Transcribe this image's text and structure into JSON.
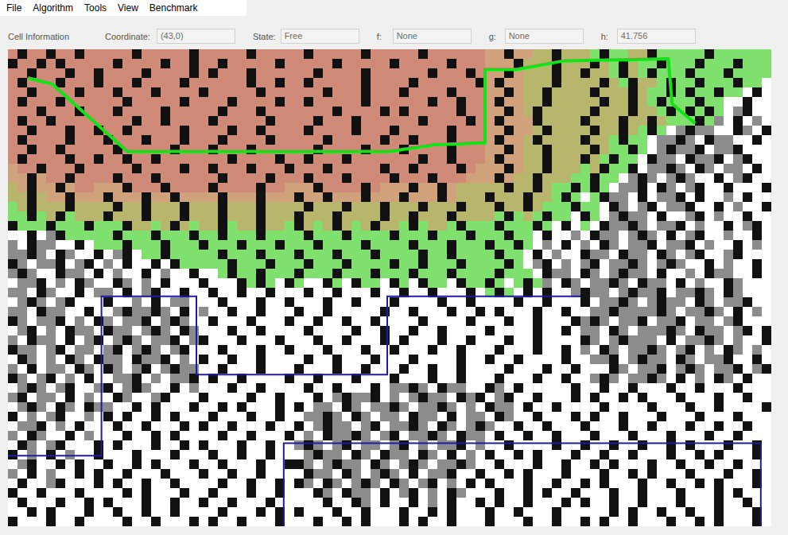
{
  "menu": [
    "File",
    "Algorithm",
    "Tools",
    "View",
    "Benchmark"
  ],
  "info": {
    "title": "Cell Information",
    "fields": [
      {
        "label": "Coordinate:",
        "value": "(43,0)"
      },
      {
        "label": "State:",
        "value": "Free"
      },
      {
        "label": "f:",
        "value": "None"
      },
      {
        "label": "g:",
        "value": "None"
      },
      {
        "label": "h:",
        "value": "41.756"
      }
    ]
  },
  "grid": {
    "rows": [
      "r#rr#rr#rrrrr#rrrrr#rrrrr#rrrrr#rrrrr#rrrrr#rrrrrroo#ooyy#yyyl#llyy#lllll#llllll",
      "#rr#r#rrrrr#rrrr#rr#rr#rrrrr#rrrrr#rrrrr#rrrrr#rrrooo#yyy#yyy#yl#yll#lll#lll#lll",
      "rr#rrr#rr#rrrr#rrrr#r#rrr#rrrrrr#rrrr#rrrrrr#rrr#roo#oyyy#yy#yyl#yl#lll#lll#llll",
      "r#rrr#rrr#rrr#rrrr#rrrrrr#rr#rr#rrrrr#rrrr#rrrrrr#o#ooyyy#yyyy#yl#yyl#ll#lll#ll.",
      "rr#rrrr#rrr#rrr#rrrr#rrrrr#rrrrrr#rrr#rrr#rrrr#rrroo#oyy#yyyy#yyy#yll#l#ll#ll.#.",
      "r#rrr#rrrrrr#rrrrr#rrrr#rrrr#rr#rrrrr#rrrrrr#rr#rro#ooyy#yyyyy#yy#yl#lll#ll..#..",
      "rrr#rrr#rrr#rrrr#rrrrr#rrr#rrrrrrr#rrrr#r#rrrrr#rroo#oy#yyyyy#yyy#yyl#l#l#l.g#..",
      "r#rr#rrrrrrrr#rr#rrrr#rrrrr#rrrr#rrr#rrrrrr#rrrr#ro#ooo#yyyy#yyy#yy#ylll#lg.#.g.",
      "rr#rrr#rr#rr#rrrrr#rrrr#rr#rrrr#rrrr#rrr#rrrrr#rrroo#ooy#yyyy#yy#yl#l.g#gg..#g.#",
      "r#rrrr#rrr#rrr#rrr#rrr#rrrr#rrrrr#rrrrr#rr#rrr#rrro#ooy#yyyy#yyl#ll.gg#g.#gg..#.",
      "rr#rr#rrrrr#rrrrr#rrr#rrr#rrrrrr#rrrr#rrr#rrrr#rrroo#oyy#yyyy#yll#l.g#gg#.gg#...",
      "r#rrrr#rr#rr#rr#rrrrrrr#rrrr#rr#rrr#rrrrrrr#rr#rrro#ooyy#yyy#yl#ll.#gg.#gg#.g#..",
      "orr#rrr#rrrrr#rrrr#rr#rrr#rrr#rrr#rrrrr#rr#rrrr#rooo#oyy#yyyly#ll#.gg#g.#g.gg.#.",
      "oo#orr#rrrr#rrr#rrrrrr#rrrr#rrr#rrr#rrrr#rrr#rrrooo#oyy#yyyll#ll.g#g.g#g..#.g#..",
      "yo#oo#orrooo#rrr#rrrr#rrrr#rrooo#rrrr#rooo#oo#oyyyyy#yy#yll#l#l.gg#.#g.g#..#...#",
      "yy#yoo#ooo#ooo#oo#oooo#ooo#ooo#oo#ooo#ooo#ooo#oyyy#yyy#yyl#l.l#gg.#.gg#.#..g.#..",
      "ly#yyy#yyyy#yy#yyy#yyy#yyy#yyyy#yyy#yyy#yyy#yyy#yyy#yy#ylll#ll.#g.g#.gg#..#.g..#",
      "ll#ly#lyyy#yyy#yyy#yyy#yyy#yyy#yyy#yyyy#yy#yyy#yyyyl#lyl#ll.#l.g#gg.#..g#.g..#..",
      "#lll#lll#lll#yyly#ylyy#lyy#yyl#yly#yly#yyl#lyyl#lll#lll#l.#.l.#gg#g.gg#.g..#.g#.",
      "..#.g#lllll#lll#lll#ll#lll#llll#lll#llll#lll#lll#lll#ll.#..g.#gg.g#g.#.g#..g..#.",
      "g.#gg..#.lll#lll#lll#lll#lll#lll#llll#llll#lll#lll#ll#l.g.#.g.#g.gg#.gg#.g..#.g.",
      "gg#g.#g..#.g#.ll#lllll#lll#lll#lll#lll#llll#ll#llll#ll.#.g..#gg.#gg.#g.g#..g#...",
      "#g.gg#.g#.g.#..#.#lllll#lll#lll#lll#llll#ll#lll#llll#l.g#.g.g#.gg#g.g#g..#.g..#.",
      "g#g..#gg.#.g..#.g..#..l#ll#lll#lll#lll#lll#lll#llll#lll.#gg.#g.g#gg.#..g.#gg..#.",
      ".gg#.g.#g..#g.g.#...#...#l#l.#l..#l.#ll.#l.#ll.#ll#l.l#lg.#g.gg#g.#gg.#.g..#g...",
      "gg.#g..#.gg.#.g#..#..#..#..#...#..#...#..#..#...#.l#l.#.#..g#gg.g#gg#.gg#g.#g..",
      ".g#g.g#...#..g.#.gg...#...#..#...#..#...#....#..#....#..#...#.gg#g.g#gg.#g.gg#..",
      "gg.#gg..#..g#gg#g.#.g..#..#...#..#.....#..#...#..#.#...#..#..gg#gggg#g.gg#g.#.g.",
      "#g.gg#.g.#g.gg#.g#g..#...#...#..#..#..#....#....#...#..#...#g#g.gg#.gg#.gg.g#...",
      ".g#.g.#gg.#gg.g#g.#g...#..#....#....#..#..#..#....#....#..#.gg.#g.ggg#g.#gg.g#.#",
      "g.#gg.#.g#.g#g.gg#.g#...#...#...#..#...#.#...#..#...#..#....#g.g#ggg.#.gg#g.g..#",
      "#gg.g#.gg.g#.g#g.g#...#...#..#...#...#..#...#..#...#...#..#.g.#g.gg#g.g#.g.#g.g.",
      ".#g.g.#g.#gg.#gg#.g.#..#..#....#..#...#...#....#..#..#....#..gg#.g#gg.#g.gg#..#.",
      "g.#.gg.#g.#g.g#.g#gg..#...#...#...#..#...#..#..#....#...#..#...#g.gg#.g#g.gg#.g#g..",
      "#g.g#.g.#..gg#.g.gg#.#..#....#..#...#...#...#..#...#...#..#..g#g.gg#g.#.g.#g.#..",
      ".g#g.g#..g#.g#g..#.g...#..#....#..#...#.gg#g.#gg..#g.#.....#..#..#...#..#...#...",
      "g#.gg.#.g..#g..g#...#....#..#...#.g#gg#.g.g#gg.#g#.g#..#...#.#..#.#...#...#..#..",
      ".g#g.#g.#gg..#.#...#..#.#...#.#.gg.#g.gg#g.gg#g.g.#gg.#..#....#....#...#..#....#",
      "#.g.g#..g.#.#..#.#...#...#..#..gg#g.#g.gg.#gg.#.gg.#g..#...#.#..#...#...#...#...",
      ".gg#.g.#...#..#...#.#..#...#..#.g#gg.g#.gg#g.#g.g#g..#..#...#...#..#...#..#..#..",
      "g.#g..#.g...#..#.#....#..#...#.g.#gg#g.g#.gg#g.#gg.#..#..#...#...#...#...#..#...",
      ".#g.g#...#.#...#..#.#...#..#..g#g.g#.gg.g#.g.gg#.g..#....#..#..#..#..#.#...#..#.",
      "#.g.#.g..#...#...#...#..#..#...g#gg.#g.#gg.#g.#.g.#..#.#...#..#..#...#..#.#...#.",
      ".g#..#.#..#..#.#...#..#...#..##g.g#gg.#g.g#g.gg#g..#...#..#..#.#...#..#..#..#...",
      "g.#.g..#.#..#...#...#..#..#....#gg.#g.g#g.#.gg#..#..#.#...#...#..#.#...#...#..#.",
      ".#..g#...#.#..#..#....#..#..#.#g.#g.g#g.#g.g#.g.#.#...#..#..#.#...#..#..#.#...#.",
      "#..#...#....#.#...#..#...#..#...#g.#gg.#.g#.g.#g...#..#.#..#...#..#...#...#.#...",
      ".#...#..#.#...#..#..#..#...#.....#..#g.#..#.g.#..#.#..#...#.#..#..#...#...#..#..#.",
      "..#.#...#..#..#..#....#...#.#.#...#..#...#..#.#...#..#...#.....#.#..#..#..#...#..",
      "#...#..#....#..#...#.#..#...#...#..#.#...#.#..#...#...#..#..#.#..#...#..#.#...#..#."
    ]
  },
  "path": [
    [
      2.1,
      3
    ],
    [
      4.6,
      3.6
    ],
    [
      12.5,
      10.7
    ],
    [
      40,
      10.7
    ],
    [
      44.6,
      10
    ],
    [
      50,
      9.8
    ],
    [
      50,
      2.1
    ],
    [
      53.3,
      2.1
    ],
    [
      58.3,
      1.2
    ],
    [
      69.2,
      1
    ],
    [
      69.6,
      5.7
    ],
    [
      72,
      7.75
    ]
  ],
  "regions": [
    [
      [
        0,
        42.6
      ],
      [
        9.8,
        42.6
      ],
      [
        9.8,
        25.9
      ],
      [
        19.75,
        25.9
      ],
      [
        19.75,
        34.1
      ],
      [
        39.75,
        34.1
      ],
      [
        39.75,
        25.9
      ],
      [
        60,
        25.9
      ]
    ],
    [
      [
        28.9,
        50
      ],
      [
        28.9,
        41.3
      ],
      [
        78.9,
        41.3
      ],
      [
        78.9,
        50
      ]
    ]
  ]
}
